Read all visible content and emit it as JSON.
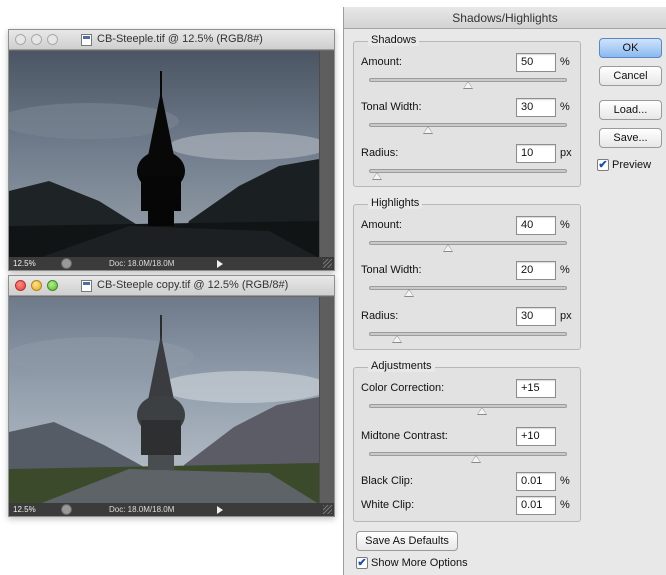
{
  "windows": [
    {
      "title": "CB-Steeple.tif @ 12.5% (RGB/8#)",
      "active": false,
      "zoom": "12.5%",
      "doc_info": "Doc: 18.0M/18.0M"
    },
    {
      "title": "CB-Steeple copy.tif @ 12.5% (RGB/8#)",
      "active": true,
      "zoom": "12.5%",
      "doc_info": "Doc: 18.0M/18.0M"
    }
  ],
  "dialog": {
    "title": "Shadows/Highlights",
    "shadows": {
      "title": "Shadows",
      "amount": {
        "label": "Amount:",
        "value": "50",
        "unit": "%",
        "slider": 0.5
      },
      "tonal_width": {
        "label": "Tonal Width:",
        "value": "30",
        "unit": "%",
        "slider": 0.3
      },
      "radius": {
        "label": "Radius:",
        "value": "10",
        "unit": "px",
        "slider": 0.04
      }
    },
    "highlights": {
      "title": "Highlights",
      "amount": {
        "label": "Amount:",
        "value": "40",
        "unit": "%",
        "slider": 0.4
      },
      "tonal_width": {
        "label": "Tonal Width:",
        "value": "20",
        "unit": "%",
        "slider": 0.2
      },
      "radius": {
        "label": "Radius:",
        "value": "30",
        "unit": "px",
        "slider": 0.14
      }
    },
    "adjustments": {
      "title": "Adjustments",
      "color_correction": {
        "label": "Color Correction:",
        "value": "+15",
        "slider": 0.57
      },
      "midtone_contrast": {
        "label": "Midtone Contrast:",
        "value": "+10",
        "slider": 0.54
      },
      "black_clip": {
        "label": "Black Clip:",
        "value": "0.01",
        "unit": "%"
      },
      "white_clip": {
        "label": "White Clip:",
        "value": "0.01",
        "unit": "%"
      }
    },
    "buttons": {
      "ok": "OK",
      "cancel": "Cancel",
      "load": "Load...",
      "save": "Save...",
      "save_defaults": "Save As Defaults"
    },
    "preview": {
      "label": "Preview",
      "checked": true
    },
    "show_more": {
      "label": "Show More Options",
      "checked": true
    }
  },
  "colors": {
    "primary_button": "#8bb9f1",
    "status_bar": "#3b3b3b"
  }
}
